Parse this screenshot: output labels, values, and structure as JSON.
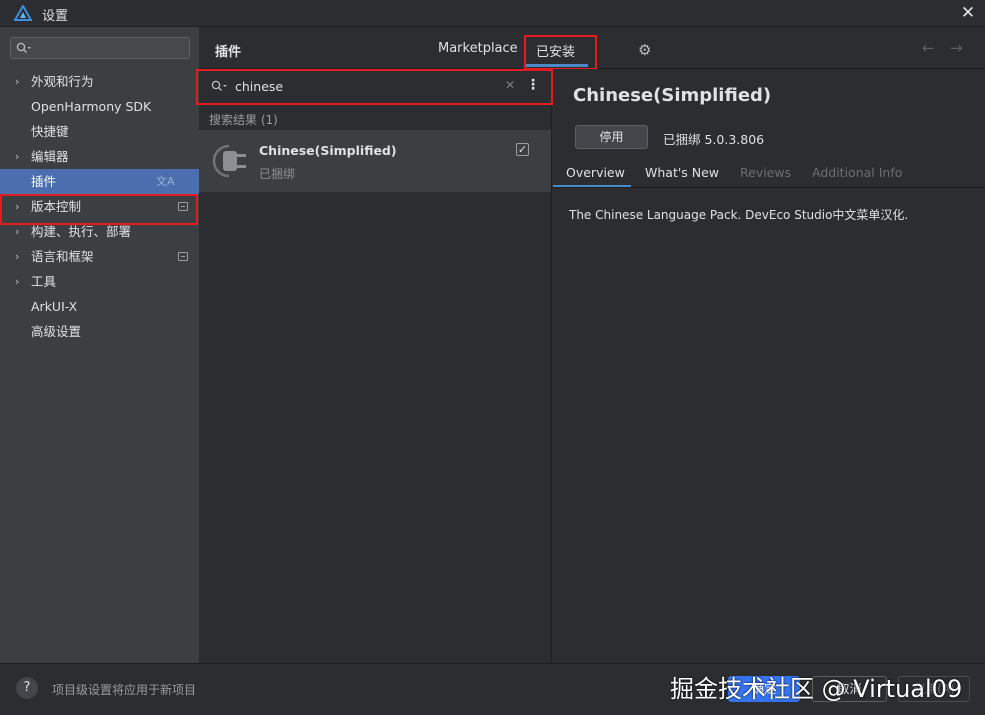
{
  "window": {
    "title": "设置"
  },
  "sidebar": {
    "search": {
      "value": ""
    },
    "items": [
      {
        "label": "外观和行为",
        "expandable": true
      },
      {
        "label": "OpenHarmony SDK",
        "expandable": false
      },
      {
        "label": "快捷键",
        "expandable": false
      },
      {
        "label": "编辑器",
        "expandable": true
      },
      {
        "label": "插件",
        "expandable": false,
        "selected": true
      },
      {
        "label": "版本控制",
        "expandable": true
      },
      {
        "label": "构建、执行、部署",
        "expandable": true
      },
      {
        "label": "语言和框架",
        "expandable": true
      },
      {
        "label": "工具",
        "expandable": true
      },
      {
        "label": "ArkUI-X",
        "expandable": false
      },
      {
        "label": "高级设置",
        "expandable": false
      }
    ]
  },
  "header": {
    "title": "插件",
    "tabs": [
      {
        "label": "Marketplace"
      },
      {
        "label": "已安装",
        "active": true
      }
    ]
  },
  "plugin_search": {
    "value": "chinese"
  },
  "results": {
    "label": "搜索结果 (1)",
    "items": [
      {
        "name": "Chinese(Simplified)",
        "status": "已捆绑",
        "enabled": true
      }
    ]
  },
  "detail": {
    "title": "Chinese(Simplified)",
    "disable_label": "停用",
    "bundled_text": "已捆绑 5.0.3.806",
    "tabs": [
      {
        "label": "Overview",
        "active": true
      },
      {
        "label": "What's New"
      },
      {
        "label": "Reviews"
      },
      {
        "label": "Additional Info"
      }
    ],
    "description": "The Chinese Language Pack. DevEco Studio中文菜单汉化."
  },
  "footer": {
    "help": "?",
    "note": "项目级设置将应用于新项目",
    "ok_label": "确定",
    "cancel_label": "取消",
    "apply_label": "应用(A)"
  },
  "watermark": "掘金技术社区 @ Virtual09",
  "colors": {
    "accent": "#4a88c7",
    "selection": "#4b6eaf",
    "highlight": "#e31b23",
    "primary_button": "#3574f0"
  },
  "icons": {
    "app": "deveco-logo-icon",
    "search": "search-icon",
    "settings": "gear-icon",
    "plugin": "plug-icon"
  }
}
